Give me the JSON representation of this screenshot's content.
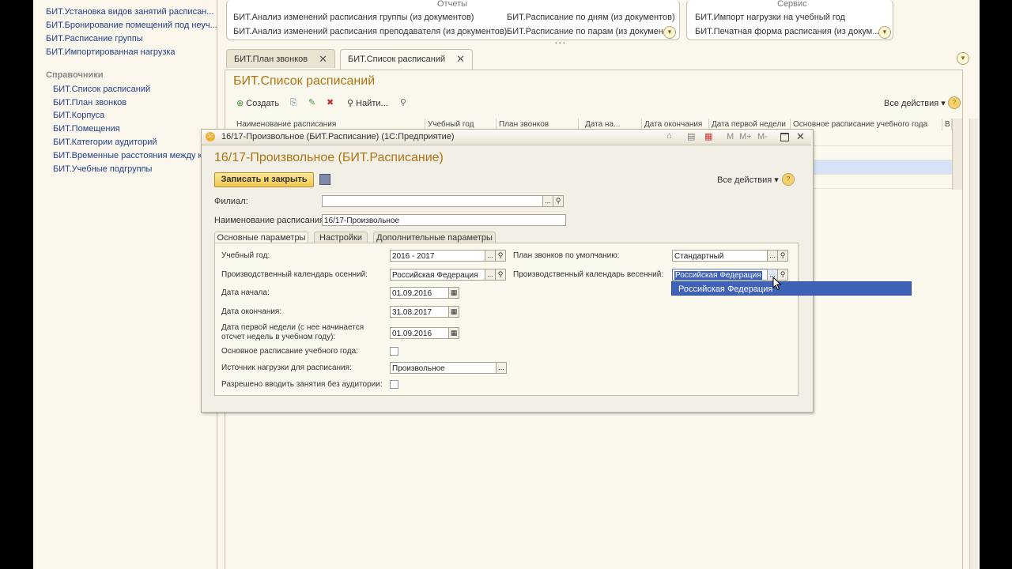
{
  "left_nav": {
    "links": [
      "БИТ.Установка видов занятий расписан...",
      "БИТ.Бронирование помещений под неуч...",
      "БИТ.Расписание группы",
      "БИТ.Импортированная нагрузка"
    ],
    "section_title": "Справочники",
    "ref_links": [
      "БИТ.Список расписаний",
      "БИТ.План звонков",
      "БИТ.Корпуса",
      "БИТ.Помещения",
      "БИТ.Категории аудиторий",
      "БИТ.Временные расстояния между ко...",
      "БИТ.Учебные подгруппы"
    ]
  },
  "reports": {
    "title": "Отчеты",
    "links_left": [
      "БИТ.Анализ изменений расписания группы (из документов)",
      "БИТ.Анализ изменений расписания преподавателя (из документов)"
    ],
    "links_right": [
      "БИТ.Расписание по дням (из документов)",
      "БИТ.Расписание по парам (из докумен..."
    ]
  },
  "service": {
    "title": "Сервис",
    "links": [
      "БИТ.Импорт нагрузки на учебный год",
      "БИТ.Печатная форма расписания (из докум..."
    ]
  },
  "tabs": [
    {
      "label": "БИТ.План звонков",
      "close": "✕"
    },
    {
      "label": "БИТ.Список расписаний",
      "close": "✕"
    }
  ],
  "list_form": {
    "title": "БИТ.Список расписаний",
    "toolbar": {
      "create": "Создать",
      "find": "Найти...",
      "all_actions": "Все действия ▾",
      "help": "?"
    },
    "columns": [
      "Наименование расписания",
      "Учебный год",
      "План звонков",
      "Дата на...",
      "Дата окончания",
      "Дата первой недели",
      "Основное расписание учебного года",
      "В"
    ]
  },
  "dialog": {
    "window_title": "16/17-Произвольное (БИТ.Расписание)  (1С:Предприятие)",
    "window_buttons": [
      "M",
      "M+",
      "M-"
    ],
    "form_title": "16/17-Произвольное (БИТ.Расписание)",
    "save_close": "Записать и закрыть",
    "all_actions": "Все действия ▾",
    "help": "?",
    "filial_label": "Филиал:",
    "filial_value": "",
    "name_label": "Наименование расписания:",
    "name_value": "16/17-Произвольное",
    "page_tabs": [
      "Основные параметры",
      "Настройки",
      "Дополнительные параметры"
    ],
    "fields": {
      "year_label": "Учебный год:",
      "year_value": "2016 - 2017",
      "autumn_cal_label": "Производственный календарь осенний:",
      "autumn_cal_value": "Российская Федерация",
      "start_label": "Дата начала:",
      "start_value": "01.09.2016",
      "end_label": "Дата окончания:",
      "end_value": "31.08.2017",
      "first_week_label_1": "Дата первой недели (с нее начинается",
      "first_week_label_2": "отсчет недель в учебном году):",
      "first_week_value": "01.09.2016",
      "main_schedule_label": "Основное расписание учебного года:",
      "source_label": "Источник нагрузки для расписания:",
      "source_value": "Произвольное",
      "allow_no_room_label": "Разрешено вводить занятия без аудитории:",
      "bells_label": "План звонков по умолчанию:",
      "bells_value": "Стандартный",
      "spring_cal_label": "Производственный календарь весенний:",
      "spring_cal_value": "Российская Федерация"
    },
    "dropdown_option": "Российская Федерация"
  }
}
